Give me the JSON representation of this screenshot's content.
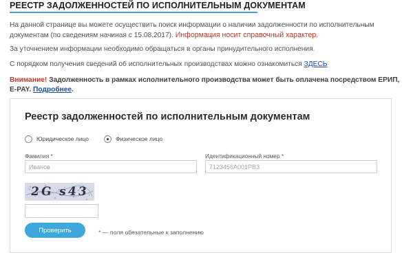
{
  "page": {
    "title": "РЕЕСТР ЗАДОЛЖЕННОСТЕЙ ПО ИСПОЛНИТЕЛЬНЫМ ДОКУМЕНТАМ",
    "intro_text": "На данной странице вы можете осуществить поиск информации о наличии задолженности по исполнительным документам (по сведениям начиная с 15.08.2017).",
    "intro_red": "Информация носит справочный характер.",
    "contact_text": "За уточнением информации необходимо обращаться в органы принудительного исполнения.",
    "procedure_text": "С порядком получения сведений об исполнительных производствах можно ознакомиться",
    "procedure_link": "ЗДЕСЬ",
    "notice_warn": "Внимание!",
    "notice_text": "Задолженность в рамках исполнительного производства может быть оплачена посредством ЕРИП, E-PAY.",
    "notice_link": "Подробнее",
    "notice_end": "."
  },
  "form": {
    "title": "Реестр задолженностей по исполнительным документам",
    "radio_legal": "Юридическое лицо",
    "radio_individual": "Физическое лицо",
    "selected": "individual",
    "surname_label": "Фамилия",
    "surname_placeholder": "Иванов",
    "id_label": "Идентификационный номер",
    "id_placeholder": "7123456А001РВ3",
    "required_star": "*",
    "captcha_text": "2G s43",
    "submit_label": "Проверить",
    "required_note": "— поля обязательные к заполнению"
  },
  "colors": {
    "accent": "#3ea7d9",
    "warning": "#c0392b",
    "link": "#1a4fa0"
  }
}
